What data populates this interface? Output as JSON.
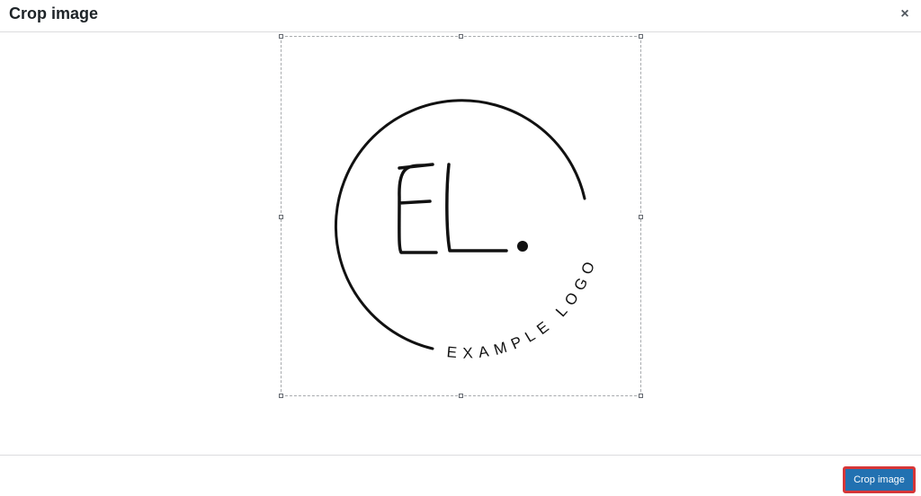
{
  "dialog": {
    "title": "Crop image",
    "close_icon": "close-icon",
    "close_glyph": "×"
  },
  "image": {
    "logo_letters": "EL.",
    "logo_tagline": "EXAMPLE LOGO"
  },
  "footer": {
    "crop_button_label": "Crop image"
  },
  "colors": {
    "primary": "#2271b1",
    "highlight": "#d63638"
  }
}
